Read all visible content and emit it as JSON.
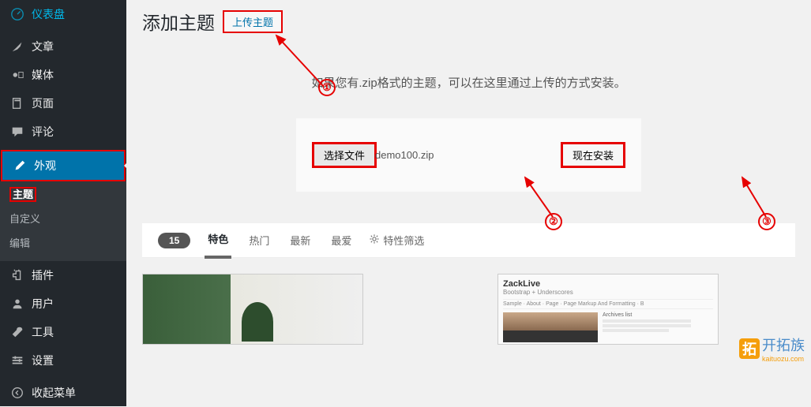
{
  "sidebar": {
    "dashboard": "仪表盘",
    "posts": "文章",
    "media": "媒体",
    "pages": "页面",
    "comments": "评论",
    "appearance": "外观",
    "plugins": "插件",
    "users": "用户",
    "tools": "工具",
    "settings": "设置",
    "collapse": "收起菜单"
  },
  "submenu": {
    "themes": "主题",
    "customize": "自定义",
    "editor": "编辑"
  },
  "header": {
    "title": "添加主题",
    "upload_btn": "上传主题"
  },
  "upload": {
    "desc": "如果您有.zip格式的主题，可以在这里通过上传的方式安装。",
    "choose_file": "选择文件",
    "file_name": "demo100.zip",
    "install_now": "现在安装"
  },
  "filter": {
    "count": "15",
    "featured": "特色",
    "popular": "热门",
    "latest": "最新",
    "favorites": "最爱",
    "feature_filter": "特性筛选"
  },
  "themes": {
    "zacklive_title": "ZackLive",
    "zacklive_sub": "Bootstrap + Underscores",
    "zacklive_archives": "Archives list"
  },
  "annotations": {
    "one": "①",
    "two": "②",
    "three": "③"
  },
  "watermark": {
    "logo": "拓",
    "text": "开拓族",
    "domain": "kaituozu.com"
  }
}
